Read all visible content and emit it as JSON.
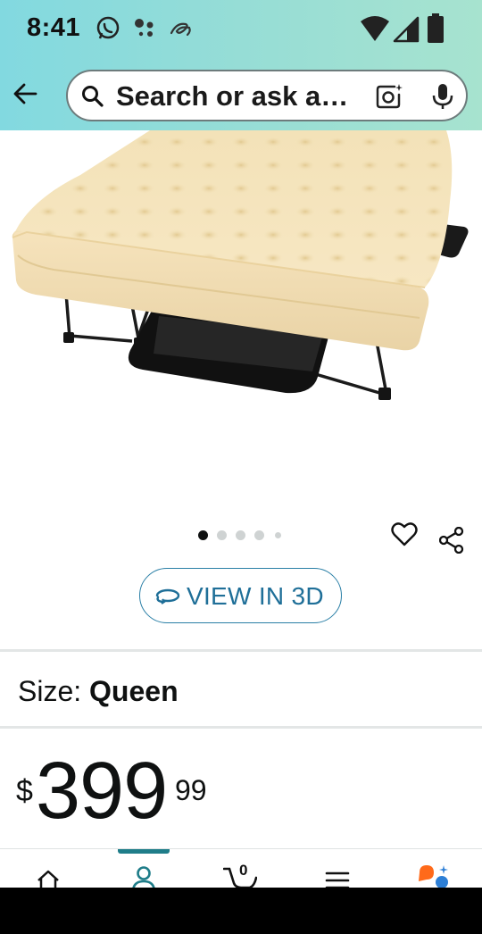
{
  "status_bar": {
    "time": "8:41",
    "left_icons": [
      "whatsapp-icon",
      "assistant-icon",
      "swirl-icon"
    ],
    "right_icons": [
      "wifi-icon",
      "cellular-icon",
      "battery-icon"
    ]
  },
  "search": {
    "placeholder": "Search or ask a…",
    "icons": [
      "back-arrow-icon",
      "search-icon",
      "camera-icon",
      "microphone-icon"
    ]
  },
  "product": {
    "image_description_icon": "air-mattress-image",
    "carousel": {
      "total": 5,
      "active": 0
    },
    "view_3d_label": "VIEW IN 3D",
    "size_label": "Size: ",
    "size_value": "Queen",
    "price": {
      "symbol": "$",
      "whole": "399",
      "fraction": "99"
    }
  },
  "bottom_nav": {
    "items": [
      "home-icon",
      "account-icon",
      "cart-icon",
      "menu-icon",
      "rufus-icon"
    ],
    "active_index": 1,
    "cart_count": "0"
  },
  "colors": {
    "header_gradient_start": "#82d9e0",
    "header_gradient_end": "#a7e3cf",
    "link_blue": "#1f6f98",
    "nav_indicator": "#1f7d89",
    "rufus_orange": "#ff6a1a",
    "rufus_blue": "#2d7fd6"
  }
}
